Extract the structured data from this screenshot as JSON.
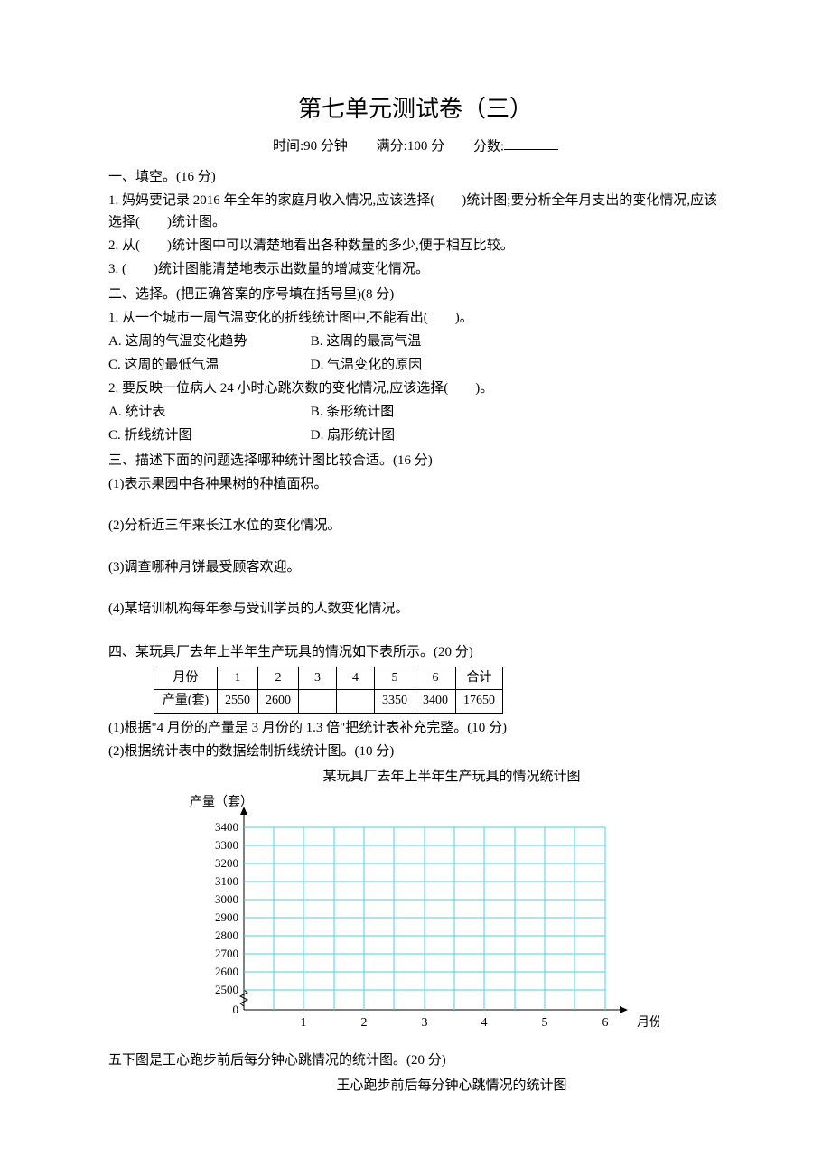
{
  "title": "第七单元测试卷（三）",
  "meta": {
    "time": "时间:90 分钟",
    "full": "满分:100 分",
    "score_label": "分数:"
  },
  "s1": {
    "heading": "一、填空。(16 分)",
    "q1": "1. 妈妈要记录 2016 年全年的家庭月收入情况,应该选择(　　)统计图;要分析全年月支出的变化情况,应该选择(　　)统计图。",
    "q2": "2. 从(　　)统计图中可以清楚地看出各种数量的多少,便于相互比较。",
    "q3": "3. (　　)统计图能清楚地表示出数量的增减变化情况。"
  },
  "s2": {
    "heading": "二、选择。(把正确答案的序号填在括号里)(8 分)",
    "q1": "1. 从一个城市一周气温变化的折线统计图中,不能看出(　　)。",
    "q1a": "A. 这周的气温变化趋势",
    "q1b": "B. 这周的最高气温",
    "q1c": "C. 这周的最低气温",
    "q1d": "D. 气温变化的原因",
    "q2": "2. 要反映一位病人 24 小时心跳次数的变化情况,应该选择(　　)。",
    "q2a": "A. 统计表",
    "q2b": "B. 条形统计图",
    "q2c": "C. 折线统计图",
    "q2d": "D. 扇形统计图"
  },
  "s3": {
    "heading": "三、描述下面的问题选择哪种统计图比较合适。(16 分)",
    "q1": "(1)表示果园中各种果树的种植面积。",
    "q2": "(2)分析近三年来长江水位的变化情况。",
    "q3": "(3)调查哪种月饼最受顾客欢迎。",
    "q4": "(4)某培训机构每年参与受训学员的人数变化情况。"
  },
  "s4": {
    "heading": "四、某玩具厂去年上半年生产玩具的情况如下表所示。(20 分)",
    "table": {
      "header": [
        "月份",
        "1",
        "2",
        "3",
        "4",
        "5",
        "6",
        "合计"
      ],
      "row_label": "产量(套)",
      "row": [
        "2550",
        "2600",
        "",
        "",
        "3350",
        "3400",
        "17650"
      ]
    },
    "sub1": "(1)根据\"4 月份的产量是 3 月份的 1.3 倍\"把统计表补充完整。(10 分)",
    "sub2": "(2)根据统计表中的数据绘制折线统计图。(10 分)",
    "chart_title": "某玩具厂去年上半年生产玩具的情况统计图"
  },
  "s5": {
    "heading": "五下图是王心跑步前后每分钟心跳情况的统计图。(20 分)",
    "chart_title": "王心跑步前后每分钟心跳情况的统计图"
  },
  "chart_data": {
    "type": "line",
    "title": "某玩具厂去年上半年生产玩具的情况统计图",
    "xlabel": "月份",
    "ylabel": "产量（套）",
    "categories": [
      "1",
      "2",
      "3",
      "4",
      "5",
      "6"
    ],
    "values": [],
    "y_ticks": [
      0,
      2500,
      2600,
      2700,
      2800,
      2900,
      3000,
      3100,
      3200,
      3300,
      3400
    ],
    "ylim": [
      0,
      3400
    ],
    "axis_break": true,
    "grid": true
  }
}
